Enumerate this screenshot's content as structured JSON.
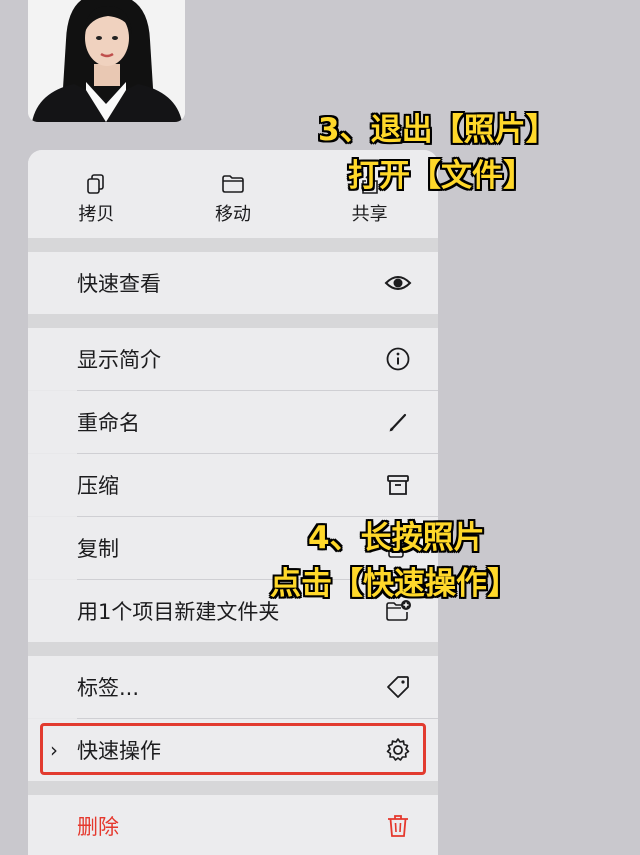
{
  "toolbar": {
    "copy_label": "拷贝",
    "move_label": "移动",
    "share_label": "共享"
  },
  "menu": {
    "quick_look": "快速查看",
    "get_info": "显示简介",
    "rename": "重命名",
    "compress": "压缩",
    "duplicate": "复制",
    "new_folder_with_item": "用1个项目新建文件夹",
    "tags": "标签...",
    "quick_actions": "快速操作",
    "delete": "删除"
  },
  "annotations": {
    "step3_line1": "3、退出【照片】",
    "step3_line2": "打开【文件】",
    "step4_line1": "4、长按照片",
    "step4_line2": "点击【快速操作】"
  },
  "colors": {
    "background": "#c9c8cd",
    "destructive": "#e5382d",
    "annotation_text": "#ffd82a",
    "highlight_border": "#e23b2f"
  }
}
